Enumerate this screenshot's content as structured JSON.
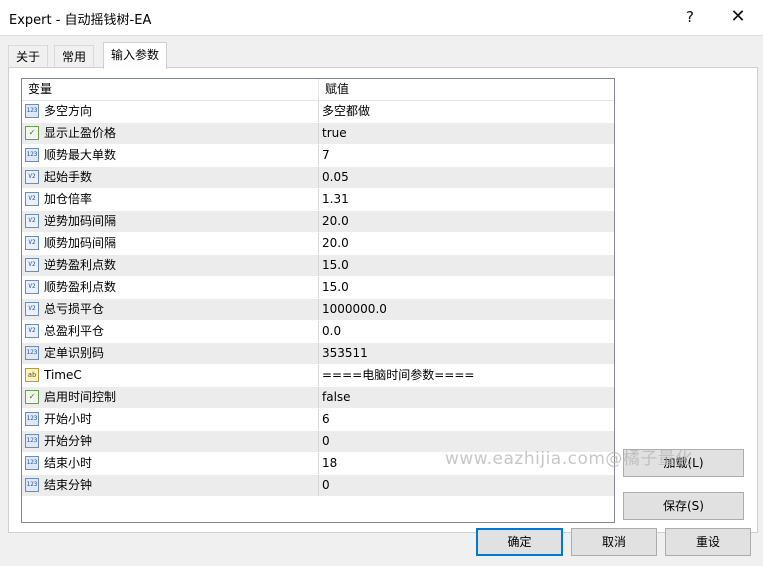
{
  "window": {
    "title": "Expert - 自动摇钱树-EA",
    "help_glyph": "?",
    "close_glyph": "✕"
  },
  "tabs": [
    {
      "label": "关于"
    },
    {
      "label": "常用"
    },
    {
      "label": "输入参数"
    }
  ],
  "table": {
    "headers": {
      "variable": "变量",
      "value": "赋值"
    },
    "rows": [
      {
        "icon": "int-icon",
        "name": "多空方向",
        "value": "多空都做"
      },
      {
        "icon": "bool-icon",
        "name": "显示止盈价格",
        "value": "true"
      },
      {
        "icon": "int-icon",
        "name": "顺势最大单数",
        "value": "7"
      },
      {
        "icon": "double-icon",
        "name": "起始手数",
        "value": "0.05"
      },
      {
        "icon": "double-icon",
        "name": "加仓倍率",
        "value": "1.31"
      },
      {
        "icon": "double-icon",
        "name": "逆势加码间隔",
        "value": "20.0"
      },
      {
        "icon": "double-icon",
        "name": "顺势加码间隔",
        "value": "20.0"
      },
      {
        "icon": "double-icon",
        "name": "逆势盈利点数",
        "value": "15.0"
      },
      {
        "icon": "double-icon",
        "name": "顺势盈利点数",
        "value": "15.0"
      },
      {
        "icon": "double-icon",
        "name": "总亏损平仓",
        "value": "1000000.0"
      },
      {
        "icon": "double-icon",
        "name": "总盈利平仓",
        "value": "0.0"
      },
      {
        "icon": "int-icon",
        "name": "定单识别码",
        "value": "353511"
      },
      {
        "icon": "string-icon",
        "name": "TimeC",
        "value": "====电脑时间参数===="
      },
      {
        "icon": "bool-icon",
        "name": "启用时间控制",
        "value": "false"
      },
      {
        "icon": "int-icon",
        "name": "开始小时",
        "value": "6"
      },
      {
        "icon": "int-icon",
        "name": "开始分钟",
        "value": "0"
      },
      {
        "icon": "int-icon",
        "name": "结束小时",
        "value": "18"
      },
      {
        "icon": "int-icon",
        "name": "结束分钟",
        "value": "0"
      }
    ]
  },
  "icon_glyphs": {
    "int-icon": "123",
    "double-icon": "V2",
    "bool-icon": "✓",
    "string-icon": "ab"
  },
  "watermark": "www.eazhijia.com@橘子量化",
  "buttons": {
    "load": "加载(L)",
    "save": "保存(S)",
    "ok": "确定",
    "cancel": "取消",
    "reset": "重设"
  },
  "colors": {
    "accent": "#0078d7",
    "row_alt": "#ececec"
  }
}
